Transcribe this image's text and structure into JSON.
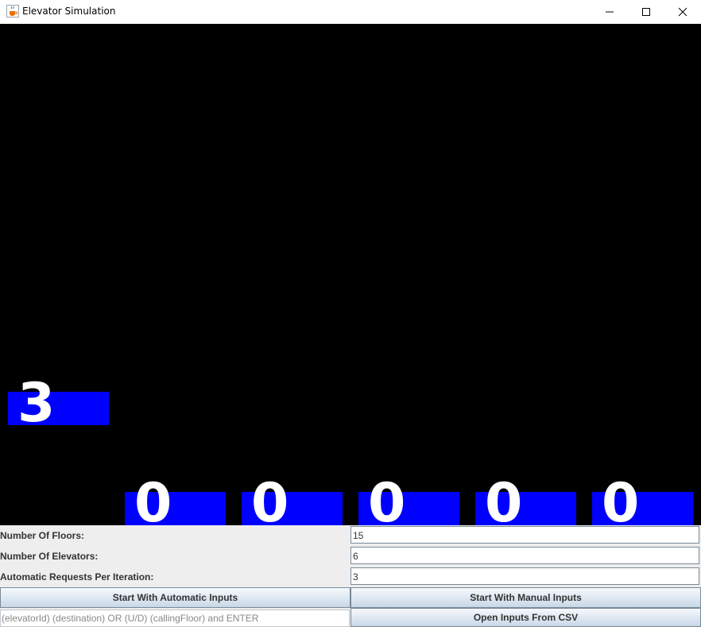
{
  "window": {
    "title": "Elevator Simulation",
    "icon": "java-cup-icon"
  },
  "colors": {
    "canvas_background": "#000000",
    "elevator_fill": "#0000ff",
    "elevator_text": "#ffffff"
  },
  "simulation": {
    "floor_indicator": "3",
    "elevators": [
      "0",
      "0",
      "0",
      "0",
      "0"
    ]
  },
  "form": {
    "floors_label": "Number Of Floors:",
    "floors_value": "15",
    "elevators_label": "Number Of Elevators:",
    "elevators_value": "6",
    "requests_label": "Automatic Requests Per Iteration:",
    "requests_value": "3",
    "auto_button": "Start With Automatic Inputs",
    "manual_button": "Start With Manual Inputs",
    "manual_placeholder": "(elevatorId) (destination) OR (U/D) (callingFloor) and ENTER",
    "csv_button": "Open Inputs From CSV"
  }
}
